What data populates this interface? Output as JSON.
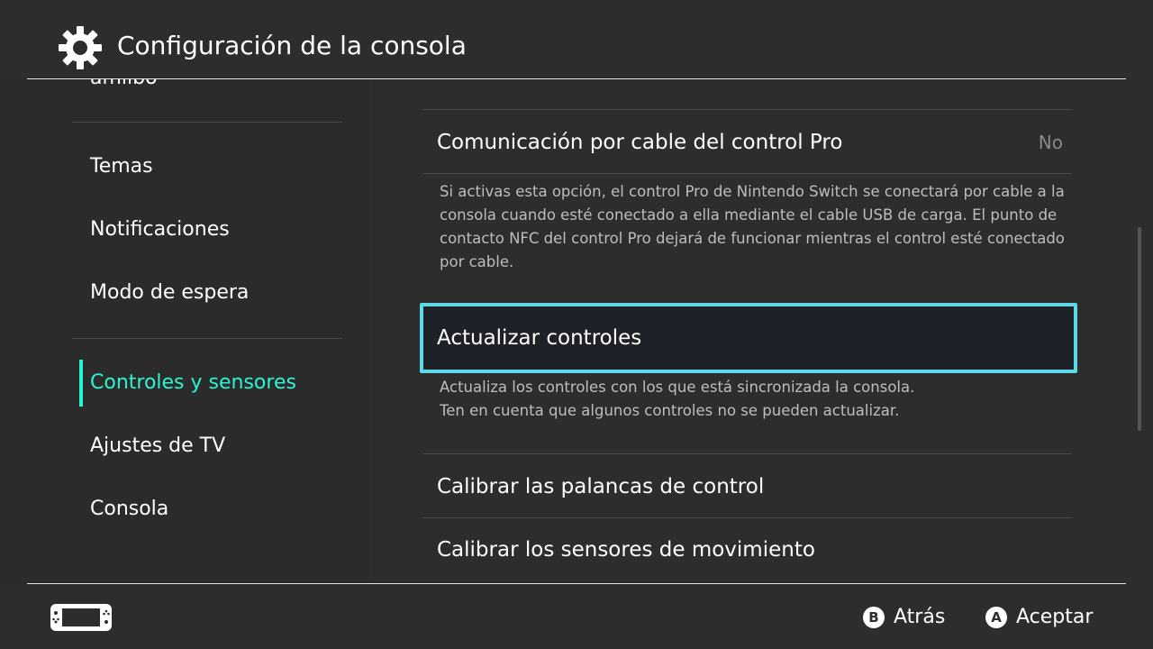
{
  "header": {
    "title": "Configuración de la consola",
    "icon": "gear-icon"
  },
  "sidebar": {
    "cut_item": "amiibo",
    "items": [
      {
        "label": "Temas"
      },
      {
        "label": "Notificaciones"
      },
      {
        "label": "Modo de espera"
      },
      {
        "label": "Controles y sensores",
        "selected": true
      },
      {
        "label": "Ajustes de TV"
      },
      {
        "label": "Consola"
      }
    ],
    "accent_color": "#2af5d0"
  },
  "content": {
    "pro_cable": {
      "label": "Comunicación por cable del control Pro",
      "value": "No",
      "description": "Si activas esta opción, el control Pro de Nintendo Switch se conectará por cable a la consola cuando esté conectado a ella mediante el cable USB de carga. El punto de contacto NFC del control Pro dejará de funcionar mientras el control esté conectado por cable."
    },
    "update_controllers": {
      "label": "Actualizar controles",
      "description_line1": "Actualiza los controles con los que está sincronizada la consola.",
      "description_line2": "Ten en cuenta que algunos controles no se pueden actualizar."
    },
    "calibrate_sticks": {
      "label": "Calibrar las palancas de control"
    },
    "calibrate_motion": {
      "label": "Calibrar los sensores de movimiento"
    },
    "focus_color": "#5ed8e6"
  },
  "footer": {
    "back": {
      "button": "B",
      "label": "Atrás"
    },
    "accept": {
      "button": "A",
      "label": "Aceptar"
    },
    "console_icon": "console-icon"
  }
}
